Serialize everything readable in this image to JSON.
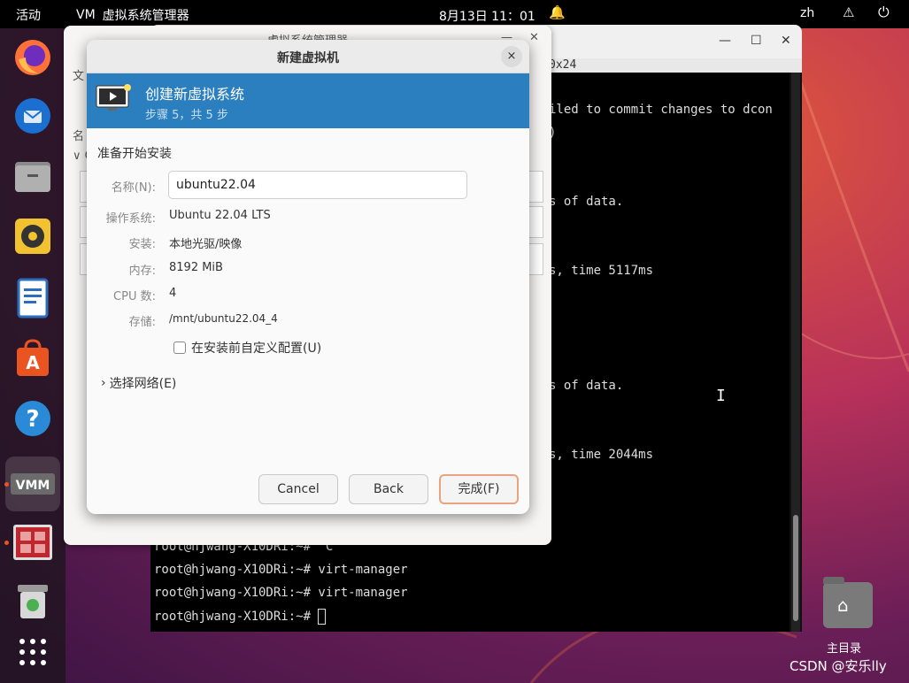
{
  "topbar": {
    "activities": "活动",
    "app_name": "虚拟系统管理器",
    "app_icon_text": "VM",
    "clock": "8月13日  11：01",
    "lang": "zh"
  },
  "terminal": {
    "tab_title": "0x24",
    "lines": [
      "iled to commit changes to dcon",
      ")",
      "s of data.",
      "s, time 5117ms",
      "s of data.",
      "s, time 2044ms",
      "root@hjwang-X10DRi:~# ^C",
      "root@hjwang-X10DRi:~# virt-manager",
      "root@hjwang-X10DRi:~# virt-manager",
      "root@hjwang-X10DRi:~# "
    ]
  },
  "vm_window": {
    "title": "虚拟系统管理器",
    "side_texts": [
      "文",
      "名",
      "∨ Q"
    ]
  },
  "dialog": {
    "title": "新建虚拟机",
    "close": "×",
    "banner_title": "创建新虚拟系统",
    "banner_sub": "步骤 5，共 5 步",
    "section": "准备开始安装",
    "name_label": "名称(N):",
    "name_value": "ubuntu22.04",
    "os_label": "操作系统:",
    "os_value": "Ubuntu 22.04 LTS",
    "install_label": "安装:",
    "install_value": "本地光驱/映像",
    "mem_label": "内存:",
    "mem_value": "8192 MiB",
    "cpu_label": "CPU 数:",
    "cpu_value": "4",
    "storage_label": "存储:",
    "storage_value": "/mnt/ubuntu22.04_4",
    "customize_label": "在安装前自定义配置(U)",
    "network_label": "选择网络(E)",
    "cancel": "Cancel",
    "back": "Back",
    "finish": "完成(F)"
  },
  "desktop": {
    "home_label": "主目录",
    "watermark": "CSDN @安乐lly"
  },
  "colors": {
    "banner": "#2b7fbf",
    "accent": "#e95420",
    "finish_border": "#e8a47e"
  }
}
